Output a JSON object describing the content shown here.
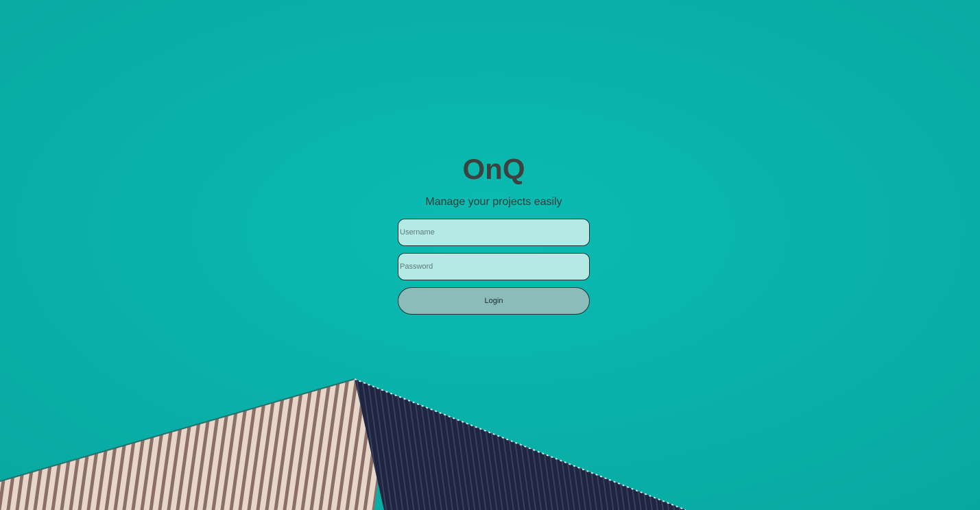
{
  "app": {
    "title": "OnQ",
    "tagline": "Manage your projects easily"
  },
  "form": {
    "username_placeholder": "Username",
    "password_placeholder": "Password",
    "login_label": "Login"
  },
  "colors": {
    "background": "#0ab3aa",
    "roof_light": "#e6d3c6",
    "roof_dark": "#1c2440"
  }
}
